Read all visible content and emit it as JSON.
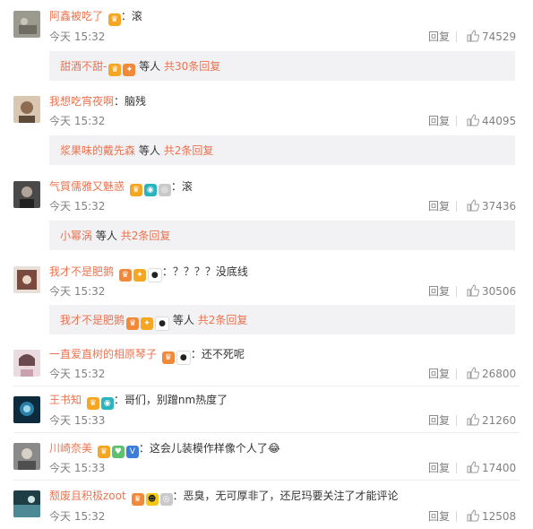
{
  "ui": {
    "reply_label": "回复",
    "separator": "："
  },
  "comments": [
    {
      "name": "阿鑫被吃了",
      "content": "滚",
      "time": "今天 15:32",
      "likes": "74529",
      "sub": {
        "name": "甜酒不甜-",
        "etc": "等人",
        "count": "共30条回复"
      },
      "avatar_color": "#9a9a8e"
    },
    {
      "name": "我想吃宵夜啊",
      "content": "脑残",
      "time": "今天 15:32",
      "likes": "44095",
      "sub": {
        "name": "浆果味的戴先森",
        "etc": "等人",
        "count": "共2条回复"
      },
      "avatar_color": "#c7a88a"
    },
    {
      "name": "气質儒雅又魅惑",
      "content": "滚",
      "time": "今天 15:32",
      "likes": "37436",
      "sub": {
        "name": "小幂涡",
        "etc": "等人",
        "count": "共2条回复"
      },
      "avatar_color": "#3a3a3a"
    },
    {
      "name": "我才不是肥鹅",
      "content": "？？？？没底线",
      "time": "今天 15:32",
      "likes": "30506",
      "sub": {
        "name": "我才不是肥鹅",
        "etc": "等人",
        "count": "共2条回复"
      },
      "avatar_color": "#7b4a3e"
    },
    {
      "name": "一直爱直树的相原琴子",
      "content": "还不死呢",
      "time": "今天 15:32",
      "likes": "26800",
      "avatar_color": "#d9c3c9"
    },
    {
      "name": "王书知",
      "content": "哥们，别蹭nm热度了",
      "time": "今天 15:33",
      "likes": "21260",
      "avatar_color": "#1c4d6b"
    },
    {
      "name": "川崎奈美",
      "content": "这会儿装模作样像个人了😂",
      "time": "今天 15:33",
      "likes": "17400",
      "avatar_color": "#6b6b6b"
    },
    {
      "name": "颓废且积极zoot",
      "content": "恶臭，无可厚非了，还尼玛要关注了才能评论",
      "time": "今天 15:32",
      "likes": "12508",
      "avatar_color": "#2f5a68"
    }
  ]
}
